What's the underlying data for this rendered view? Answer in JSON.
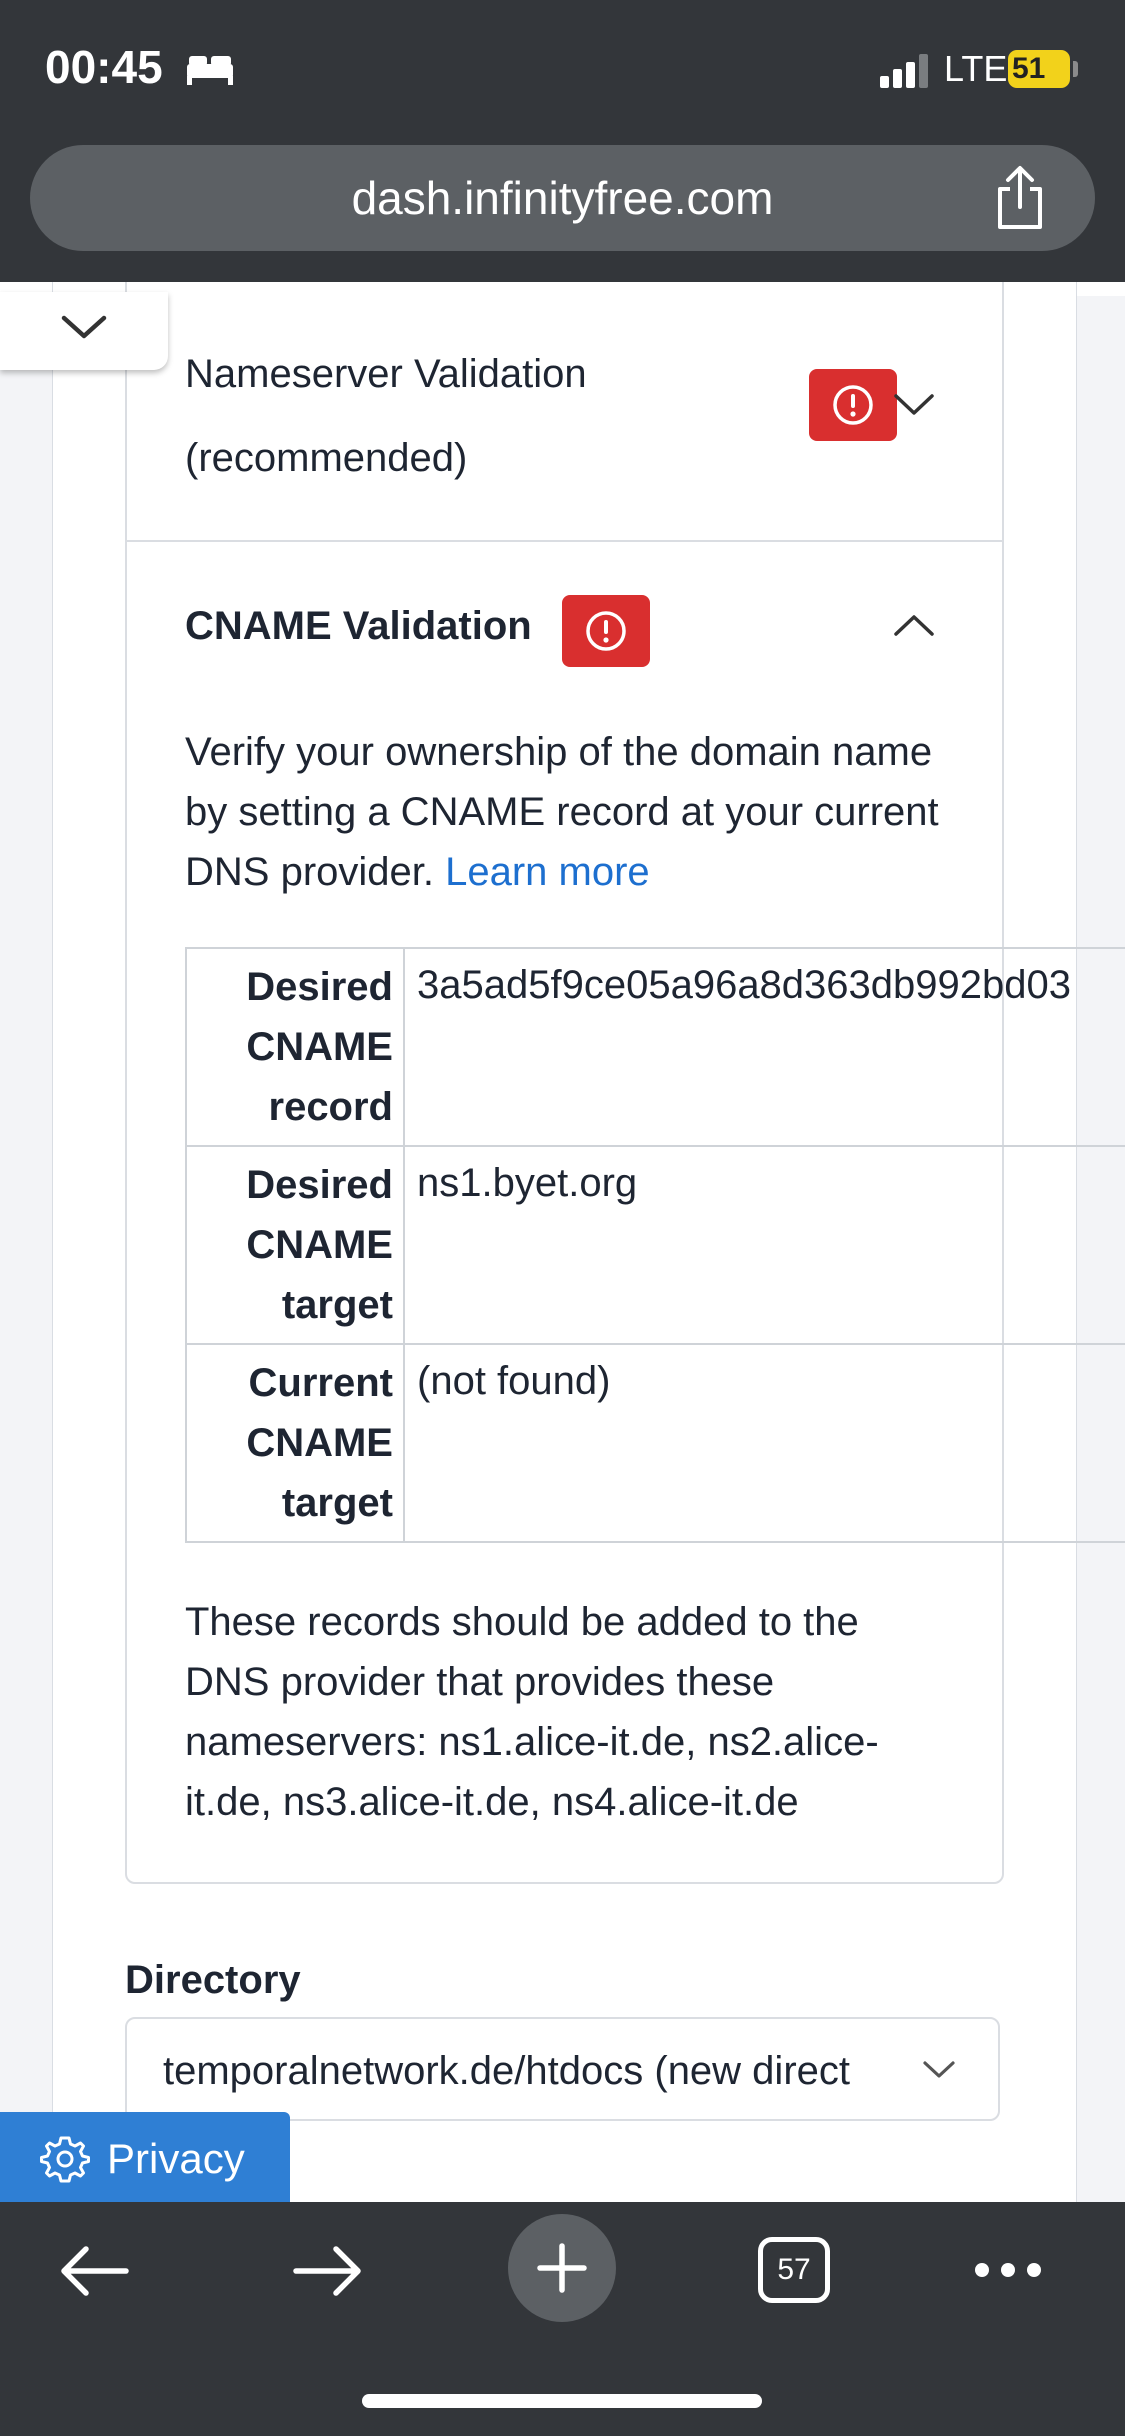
{
  "status_bar": {
    "time": "00:45",
    "network": "LTE",
    "battery": "51"
  },
  "browser": {
    "url": "dash.infinityfree.com",
    "tab_count": "57"
  },
  "nameserver_validation": {
    "title_line1": "Nameserver Validation",
    "title_line2": "(recommended)"
  },
  "cname_validation": {
    "title": "CNAME Validation",
    "description": "Verify your ownership of the domain name by setting a CNAME record at your current DNS provider.",
    "learn_more": "Learn more",
    "rows": [
      {
        "key_line1": "Desired",
        "key_line2": "CNAME",
        "key_line3": "record",
        "value": "3a5ad5f9ce05a96a8d363db992bd03"
      },
      {
        "key_line1": "Desired",
        "key_line2": "CNAME",
        "key_line3": "target",
        "value": "ns1.byet.org"
      },
      {
        "key_line1": "Current",
        "key_line2": "CNAME",
        "key_line3": "target",
        "value": "(not found)"
      }
    ],
    "note": "These records should be added to the DNS provider that provides these nameservers: ns1.alice-it.de, ns2.alice-it.de, ns3.alice-it.de, ns4.alice-it.de"
  },
  "directory": {
    "label": "Directory",
    "value": "temporalnetwork.de/htdocs (new direct"
  },
  "privacy": {
    "label": "Privacy"
  },
  "colors": {
    "error_badge": "#d92f2f",
    "link": "#1d6fcf",
    "privacy_button": "#2f7fd4",
    "chrome": "#33363a"
  }
}
